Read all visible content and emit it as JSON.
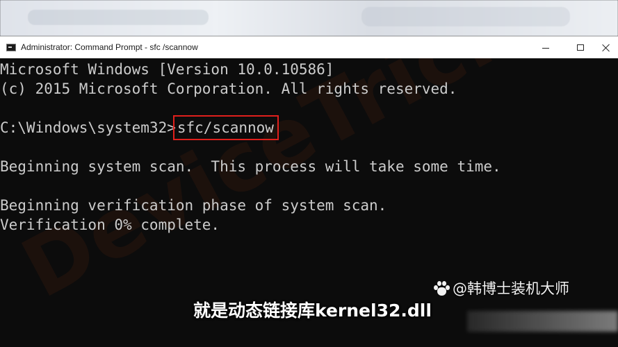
{
  "window": {
    "title": "Administrator: Command Prompt - sfc /scannow",
    "icon": "cmd-icon",
    "controls": {
      "minimize_icon": "minimize-icon",
      "maximize_icon": "maximize-icon",
      "close_icon": "close-icon"
    }
  },
  "console": {
    "background": "#0c0c0c",
    "text_color": "#cccccc",
    "lines": [
      "Microsoft Windows [Version 10.0.10586]",
      "(c) 2015 Microsoft Corporation. All rights reserved.",
      "",
      "Beginning system scan.  This process will take some time.",
      "",
      "Beginning verification phase of system scan.",
      "Verification 0% complete."
    ],
    "prompt": "C:\\Windows\\system32>",
    "command": "sfc/scannow",
    "highlight_color": "#e0201c",
    "verification_progress_percent": 0
  },
  "overlay": {
    "watermark": "DeviceTricks",
    "source_tag": "@韩博士装机大师",
    "source_icon": "paw-icon",
    "subtitle": "就是动态链接库kernel32.dll"
  }
}
